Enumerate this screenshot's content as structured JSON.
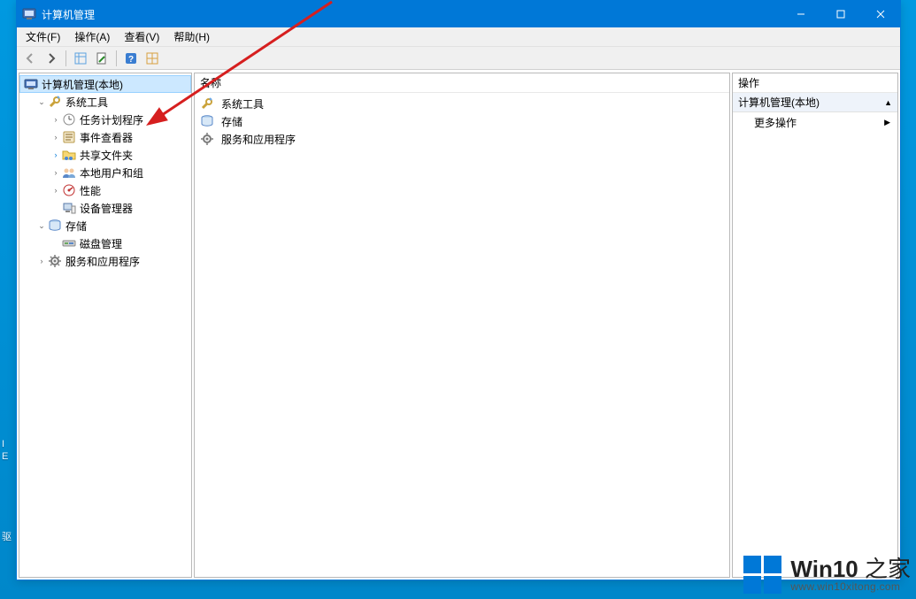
{
  "window": {
    "title": "计算机管理"
  },
  "menu": {
    "file": "文件(F)",
    "action": "操作(A)",
    "view": "查看(V)",
    "help": "帮助(H)"
  },
  "tree": {
    "root": "计算机管理(本地)",
    "systools": "系统工具",
    "task_scheduler": "任务计划程序",
    "event_viewer": "事件查看器",
    "shared_folders": "共享文件夹",
    "local_users": "本地用户和组",
    "performance": "性能",
    "device_manager": "设备管理器",
    "storage": "存储",
    "disk_mgmt": "磁盘管理",
    "services_apps": "服务和应用程序"
  },
  "mid": {
    "col_name": "名称",
    "item_systools": "系统工具",
    "item_storage": "存储",
    "item_services": "服务和应用程序"
  },
  "actions": {
    "header": "操作",
    "section": "计算机管理(本地)",
    "more": "更多操作"
  },
  "watermark": {
    "brand": "Win10",
    "suffix": " 之家",
    "url": "www.win10xitong.com"
  },
  "desktop": {
    "label_I": "I",
    "label_E": "E",
    "label_drive": "驱"
  }
}
